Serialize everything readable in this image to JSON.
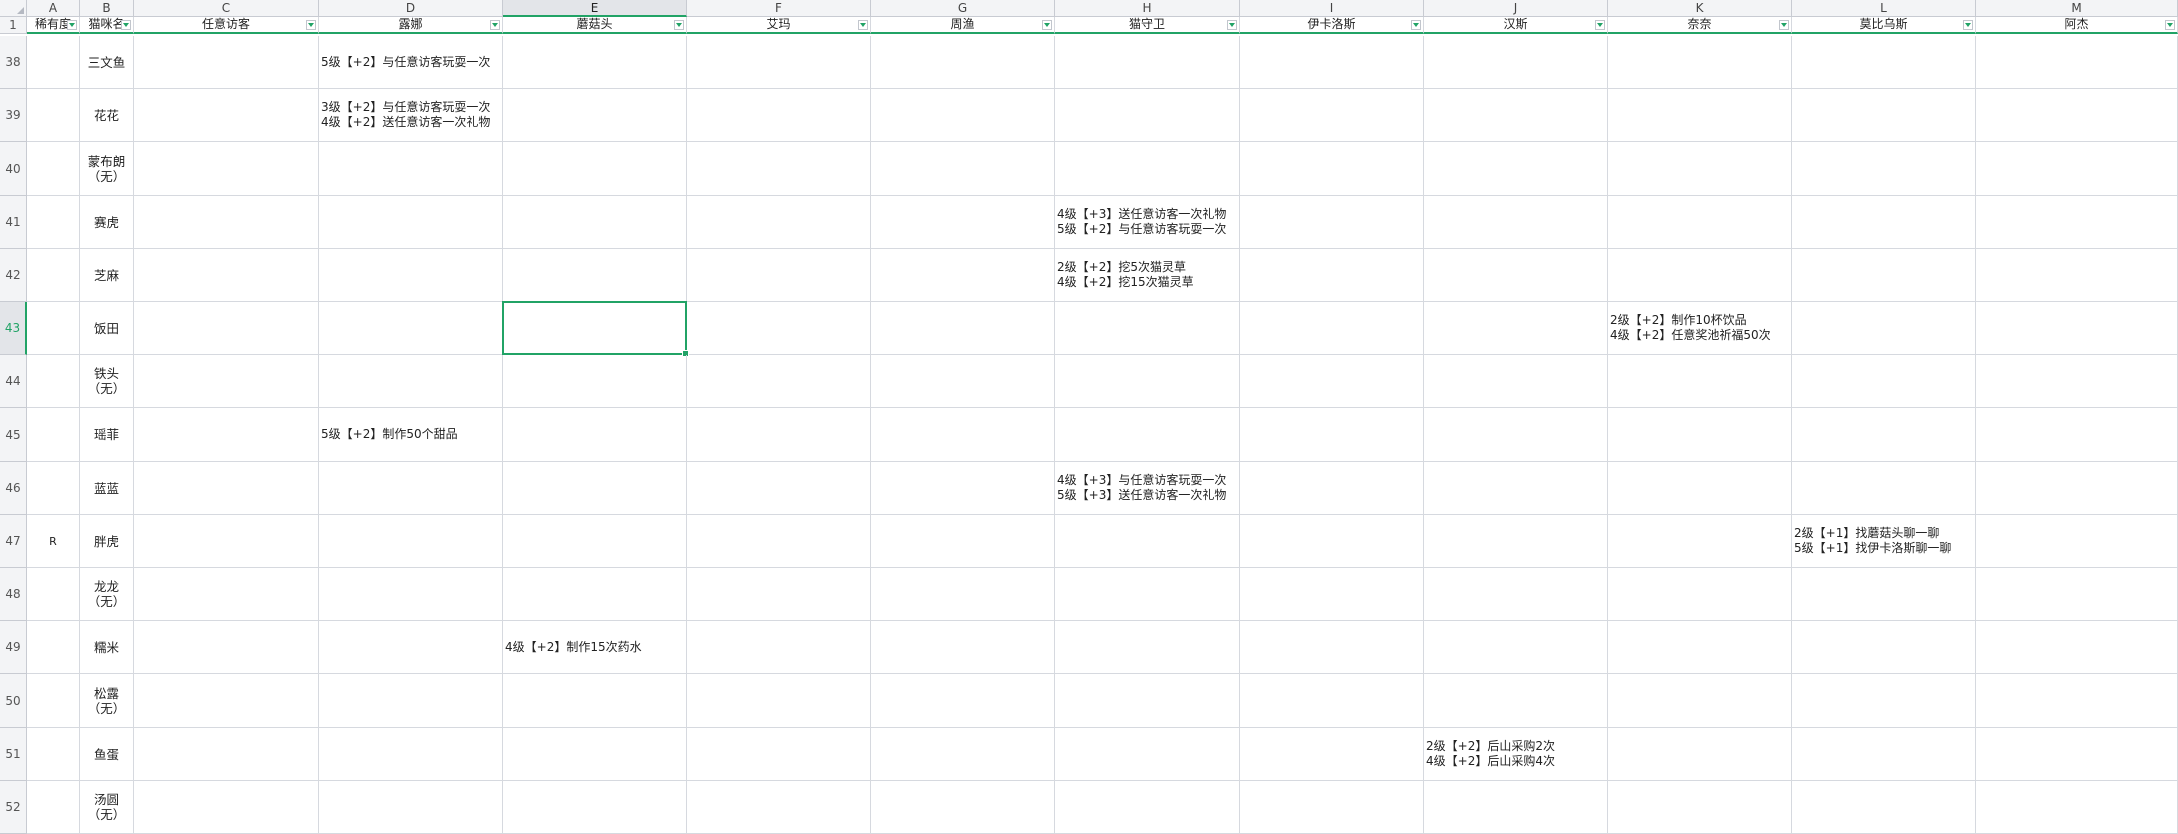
{
  "columns": [
    {
      "letter": "A",
      "header": "稀有度"
    },
    {
      "letter": "B",
      "header": "猫咪名"
    },
    {
      "letter": "C",
      "header": "任意访客"
    },
    {
      "letter": "D",
      "header": "露娜"
    },
    {
      "letter": "E",
      "header": "蘑菇头"
    },
    {
      "letter": "F",
      "header": "艾玛"
    },
    {
      "letter": "G",
      "header": "周渔"
    },
    {
      "letter": "H",
      "header": "猫守卫"
    },
    {
      "letter": "I",
      "header": "伊卡洛斯"
    },
    {
      "letter": "J",
      "header": "汉斯"
    },
    {
      "letter": "K",
      "header": "奈奈"
    },
    {
      "letter": "L",
      "header": "莫比乌斯"
    },
    {
      "letter": "M",
      "header": "阿杰"
    }
  ],
  "selected_column": "E",
  "selected_row": "43",
  "header_row_number": "1",
  "rows": [
    {
      "num": "38",
      "rarity": "",
      "name": [
        "三文鱼"
      ],
      "cells": {
        "D": [
          "5级【+2】与任意访客玩耍一次"
        ]
      }
    },
    {
      "num": "39",
      "rarity": "",
      "name": [
        "花花"
      ],
      "cells": {
        "D": [
          "3级【+2】与任意访客玩耍一次",
          "4级【+2】送任意访客一次礼物"
        ]
      }
    },
    {
      "num": "40",
      "rarity": "",
      "name": [
        "蒙布朗",
        "（无）"
      ],
      "cells": {}
    },
    {
      "num": "41",
      "rarity": "",
      "name": [
        "赛虎"
      ],
      "cells": {
        "H": [
          "4级【+3】送任意访客一次礼物",
          "5级【+2】与任意访客玩耍一次"
        ]
      }
    },
    {
      "num": "42",
      "rarity": "",
      "name": [
        "芝麻"
      ],
      "cells": {
        "H": [
          "2级【+2】挖5次猫灵草",
          "4级【+2】挖15次猫灵草"
        ]
      }
    },
    {
      "num": "43",
      "rarity": "",
      "name": [
        "饭田"
      ],
      "cells": {
        "K": [
          "2级【+2】制作10杯饮品",
          "4级【+2】任意奖池祈福50次"
        ]
      }
    },
    {
      "num": "44",
      "rarity": "",
      "name": [
        "铁头",
        "（无）"
      ],
      "cells": {}
    },
    {
      "num": "45",
      "rarity": "",
      "name": [
        "瑶菲"
      ],
      "cells": {
        "D": [
          "5级【+2】制作50个甜品"
        ]
      }
    },
    {
      "num": "46",
      "rarity": "",
      "name": [
        "蓝蓝"
      ],
      "cells": {
        "H": [
          "4级【+3】与任意访客玩耍一次",
          "5级【+3】送任意访客一次礼物"
        ]
      }
    },
    {
      "num": "47",
      "rarity": "R",
      "name": [
        "胖虎"
      ],
      "cells": {
        "L": [
          "2级【+1】找蘑菇头聊一聊",
          "5级【+1】找伊卡洛斯聊一聊"
        ]
      }
    },
    {
      "num": "48",
      "rarity": "",
      "name": [
        "龙龙",
        "（无）"
      ],
      "cells": {}
    },
    {
      "num": "49",
      "rarity": "",
      "name": [
        "糯米"
      ],
      "cells": {
        "E": [
          "4级【+2】制作15次药水"
        ]
      }
    },
    {
      "num": "50",
      "rarity": "",
      "name": [
        "松露",
        "（无）"
      ],
      "cells": {}
    },
    {
      "num": "51",
      "rarity": "",
      "name": [
        "鱼蛋"
      ],
      "cells": {
        "J": [
          "2级【+2】后山采购2次",
          "4级【+2】后山采购4次"
        ]
      }
    },
    {
      "num": "52",
      "rarity": "",
      "name": [
        "汤圆",
        "（无）"
      ],
      "cells": {}
    }
  ]
}
